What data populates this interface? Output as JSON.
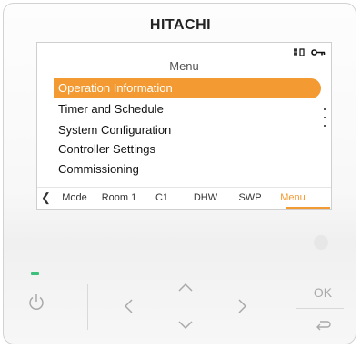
{
  "brand": "HITACHI",
  "screen": {
    "status_icons": [
      "ₙ̸",
      "⊸"
    ],
    "menu_title": "Menu",
    "menu_items": [
      "Operation Information",
      "Timer and Schedule",
      "System Configuration",
      "Controller Settings",
      "Commissioning"
    ],
    "tabs": [
      "Mode",
      "Room 1",
      "C1",
      "DHW",
      "SWP",
      "Menu"
    ],
    "active_tab": "Menu"
  },
  "buttons": {
    "ok_label": "OK"
  },
  "colors": {
    "accent": "#f39b32",
    "power_led": "#3cc07b"
  }
}
